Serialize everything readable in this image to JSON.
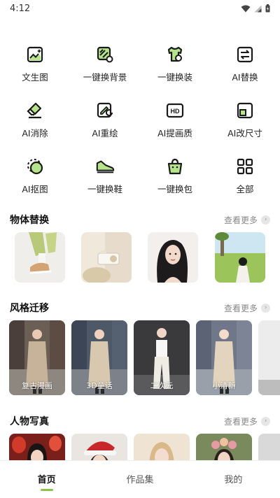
{
  "status_bar": {
    "time": "4:12"
  },
  "tools": [
    {
      "label": "文生图",
      "icon": "text-to-image-icon"
    },
    {
      "label": "一键换背景",
      "icon": "change-background-icon"
    },
    {
      "label": "一键换装",
      "icon": "change-outfit-icon"
    },
    {
      "label": "AI替换",
      "icon": "ai-replace-icon"
    },
    {
      "label": "AI消除",
      "icon": "eraser-icon"
    },
    {
      "label": "AI重绘",
      "icon": "repaint-icon"
    },
    {
      "label": "AI提画质",
      "icon": "hd-enhance-icon"
    },
    {
      "label": "AI改尺寸",
      "icon": "resize-icon"
    },
    {
      "label": "AI抠图",
      "icon": "cutout-icon"
    },
    {
      "label": "一键换鞋",
      "icon": "change-shoes-icon"
    },
    {
      "label": "一键换包",
      "icon": "change-bag-icon"
    },
    {
      "label": "全部",
      "icon": "grid-all-icon"
    }
  ],
  "sections": {
    "object_replace": {
      "title": "物体替换",
      "more": "查看更多"
    },
    "style_transfer": {
      "title": "风格迁移",
      "more": "查看更多",
      "captions": [
        "复古漫画",
        "3D童话",
        "二次元",
        "小清新"
      ]
    },
    "portrait": {
      "title": "人物写真",
      "more": "查看更多"
    }
  },
  "tabs": [
    {
      "label": "首页"
    },
    {
      "label": "作品集"
    },
    {
      "label": "我的"
    }
  ],
  "colors": {
    "accent": "#8bc34a",
    "icon_green": "#b5e48c"
  }
}
